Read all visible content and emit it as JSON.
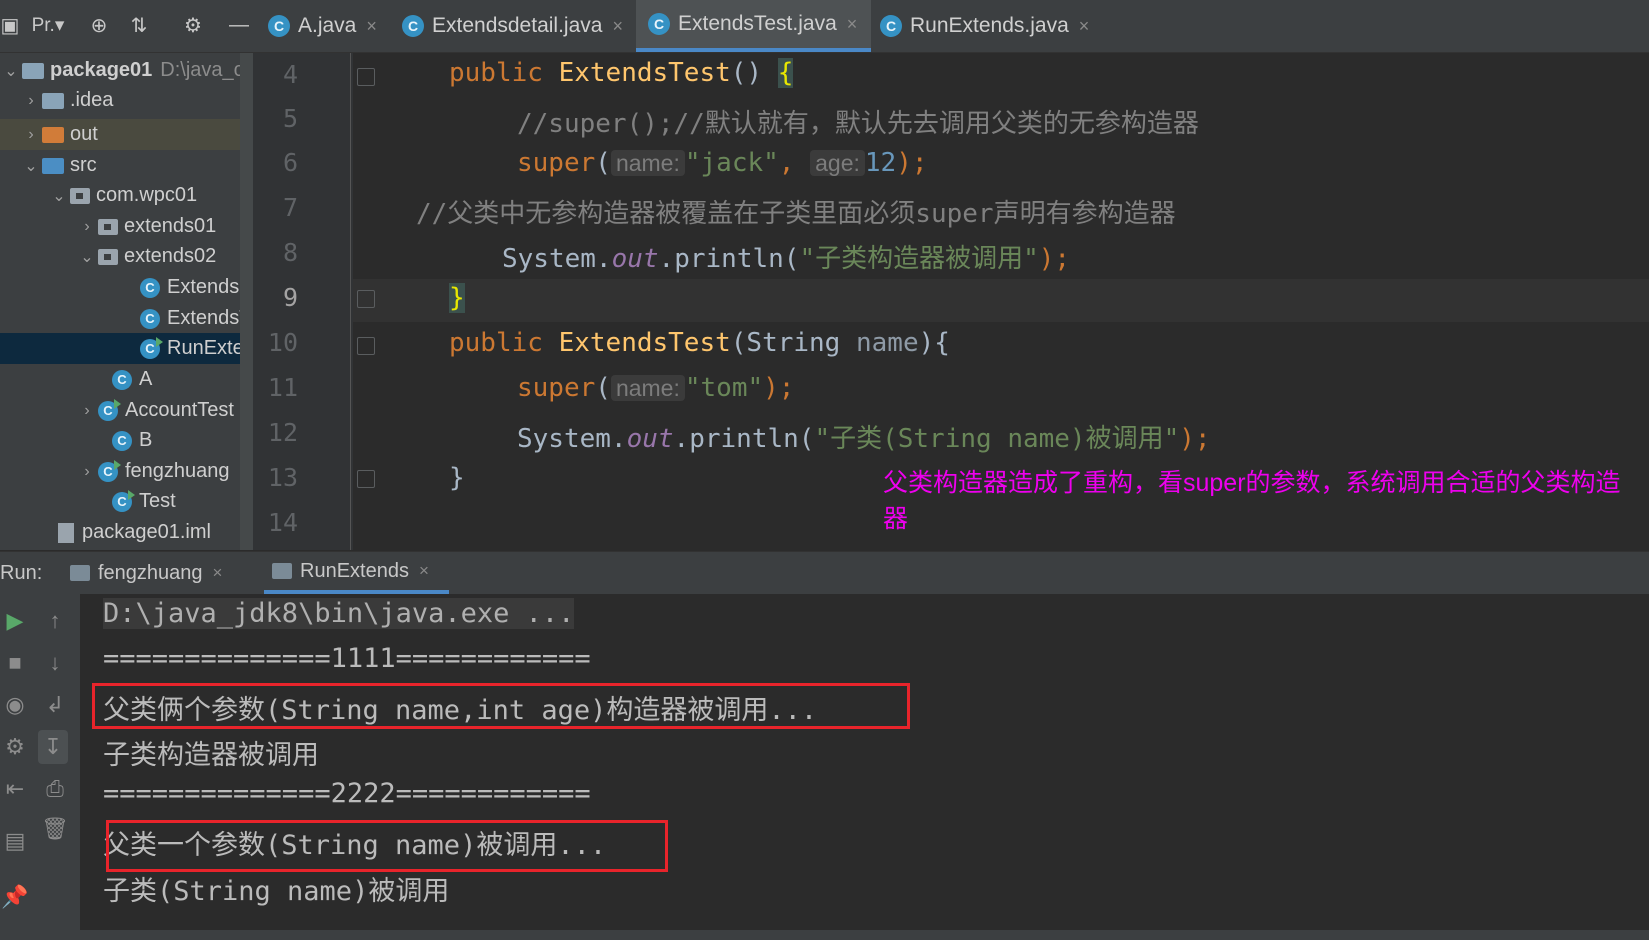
{
  "toolbar": {
    "project_label": "Pr.▾"
  },
  "editor_tabs": [
    {
      "label": "A.java"
    },
    {
      "label": "Extendsdetail.java"
    },
    {
      "label": "ExtendsTest.java"
    },
    {
      "label": "RunExtends.java"
    }
  ],
  "tree": {
    "root": {
      "name": "package01",
      "path": "D:\\java_c"
    },
    "items": [
      "idea",
      "out",
      "src",
      "com.wpc01",
      "extends01",
      "extends02",
      "Extendsd",
      "ExtendsT",
      "RunExter",
      "A",
      "AccountTest",
      "B",
      "fengzhuang",
      "Test",
      "package01.iml"
    ],
    "idea_label": ".idea"
  },
  "code": {
    "line_numbers": [
      "4",
      "5",
      "6",
      "7",
      "8",
      "9",
      "10",
      "11",
      "12",
      "13",
      "14"
    ],
    "l4_kw": "public",
    "l4_fn": "ExtendsTest",
    "l4_paren": "() ",
    "l4_brace": "{",
    "l5": "//super();//默认就有，默认先去调用父类的无参构造器",
    "l6_kw": "super",
    "l6_open": "(",
    "l6_hint_name": "name:",
    "l6_str": "\"jack\"",
    "l6_comma": ",",
    "l6_hint_age": "age:",
    "l6_num": "12",
    "l6_close": ");",
    "l7": "//父类中无参构造器被覆盖在子类里面必须super声明有参构造器",
    "l8_a": "System.",
    "l8_fld": "out",
    "l8_b": ".println(",
    "l8_str": "\"子类构造器被调用\"",
    "l8_c": ");",
    "l9": "}",
    "l10_kw": "public",
    "l10_fn": "ExtendsTest",
    "l10_a": "(String ",
    "l10_param": "name",
    "l10_b": "){",
    "l11_kw": "super",
    "l11_open": "(",
    "l11_hint": "name:",
    "l11_str": "\"tom\"",
    "l11_close": ");",
    "l12_a": "System.",
    "l12_fld": "out",
    "l12_b": ".println(",
    "l12_str": "\"子类(String name)被调用\"",
    "l12_c": ");",
    "l13": "}"
  },
  "annotation": "父类构造器造成了重构，看super的参数，系统调用合适的父类构造器",
  "run": {
    "label": "Run:",
    "tabs": [
      {
        "label": "fengzhuang"
      },
      {
        "label": "RunExtends"
      }
    ],
    "output": [
      "D:\\java_jdk8\\bin\\java.exe ...",
      "==============1111============",
      "父类俩个参数(String name,int age)构造器被调用...",
      "子类构造器被调用",
      "==============2222============",
      "父类一个参数(String name)被调用...",
      "子类(String name)被调用"
    ]
  },
  "colors": {
    "accent": "#4a88c7",
    "annotation": "#ee00ee",
    "highlight_box": "#e8242b"
  }
}
